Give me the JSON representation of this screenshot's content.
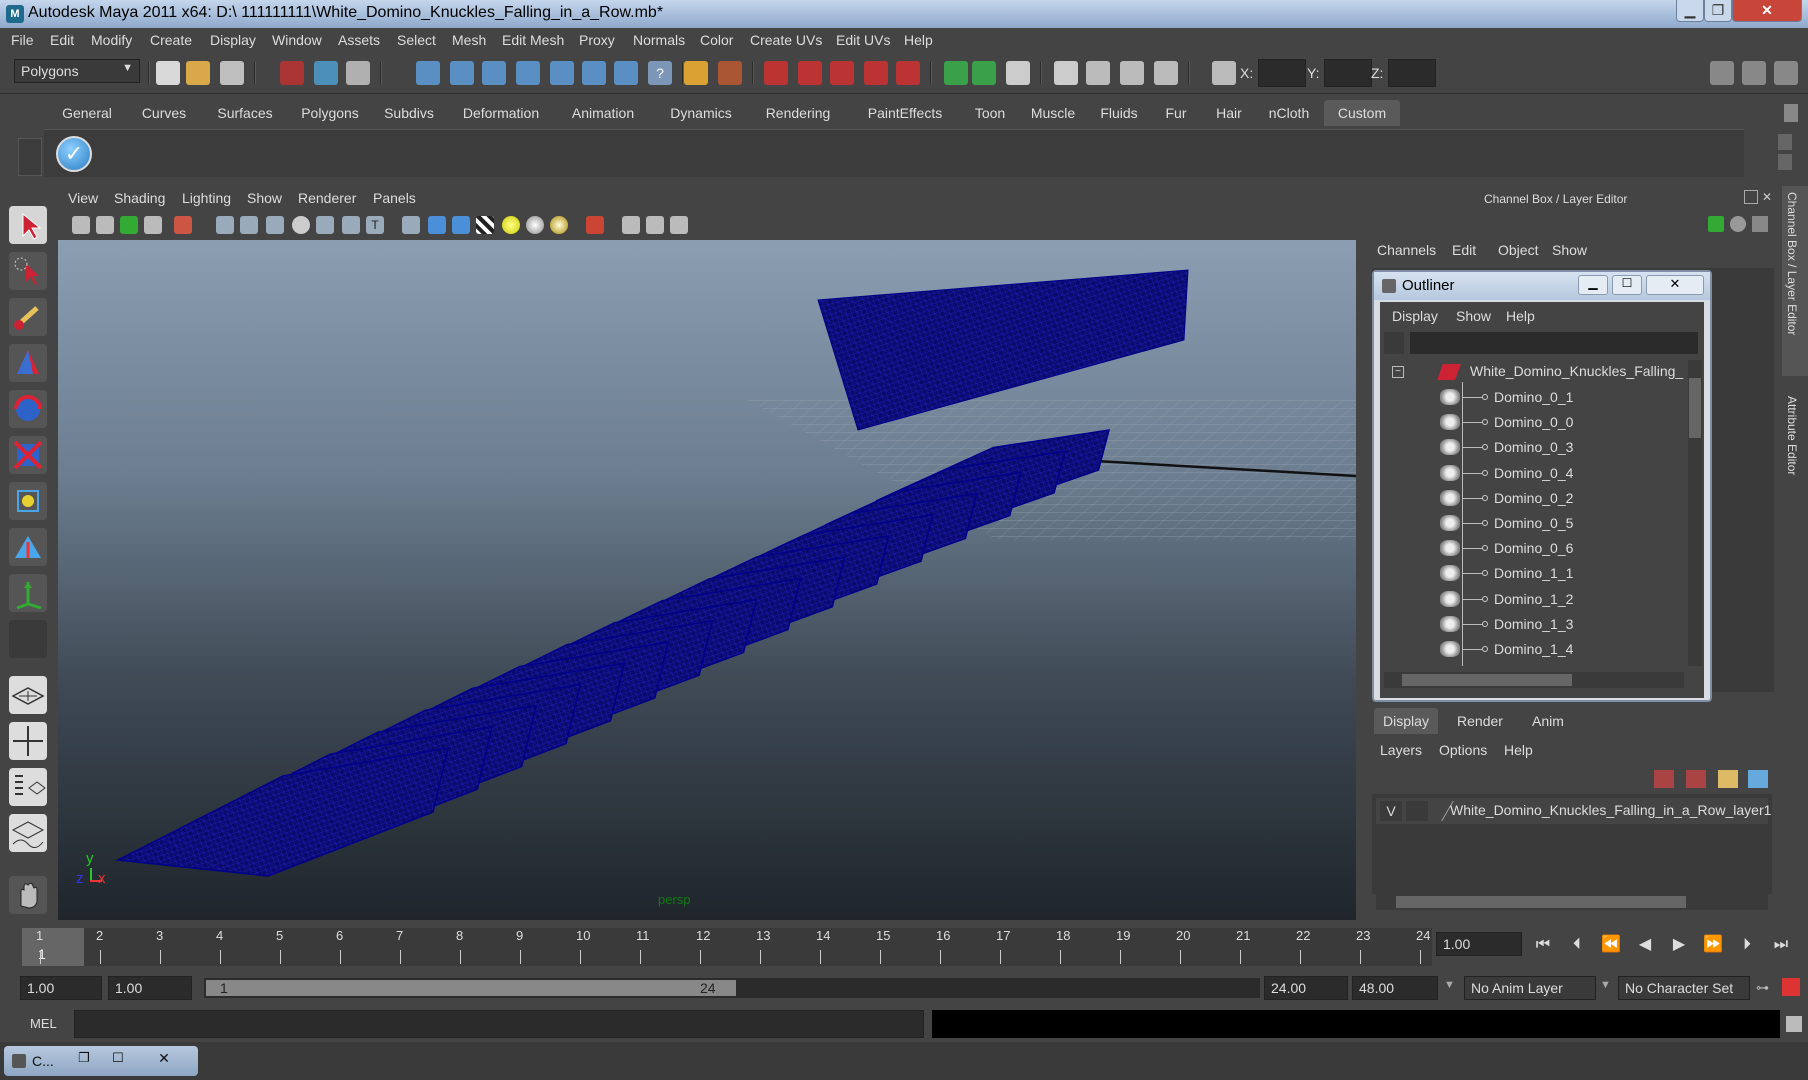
{
  "window": {
    "title": "Autodesk Maya 2011 x64: D:\\ 111111111\\White_Domino_Knuckles_Falling_in_a_Row.mb*",
    "app_icon": "M"
  },
  "menubar": [
    "File",
    "Edit",
    "Modify",
    "Create",
    "Display",
    "Window",
    "Assets",
    "Select",
    "Mesh",
    "Edit Mesh",
    "Proxy",
    "Normals",
    "Color",
    "Create UVs",
    "Edit UVs",
    "Help"
  ],
  "statusline": {
    "mode": "Polygons",
    "x_label": "X:",
    "y_label": "Y:",
    "z_label": "Z:"
  },
  "shelf": {
    "tabs": [
      "General",
      "Curves",
      "Surfaces",
      "Polygons",
      "Subdivs",
      "Deformation",
      "Animation",
      "Dynamics",
      "Rendering",
      "PaintEffects",
      "Toon",
      "Muscle",
      "Fluids",
      "Fur",
      "Hair",
      "nCloth",
      "Custom"
    ],
    "active_tab": "Custom"
  },
  "viewport": {
    "menus": [
      "View",
      "Shading",
      "Lighting",
      "Show",
      "Renderer",
      "Panels"
    ],
    "camera_label": "persp",
    "axis_y": "y",
    "axis_x": "x",
    "axis_z": "z",
    "wire_color": "#00008a"
  },
  "channel_box": {
    "title": "Channel Box / Layer Editor",
    "menus": [
      "Channels",
      "Edit",
      "Object",
      "Show"
    ],
    "side_tab_1": "Channel Box / Layer Editor",
    "side_tab_2": "Attribute Editor"
  },
  "outliner": {
    "title": "Outliner",
    "menus": [
      "Display",
      "Show",
      "Help"
    ],
    "root": "White_Domino_Knuckles_Falling_in",
    "items": [
      "Domino_0_1",
      "Domino_0_0",
      "Domino_0_3",
      "Domino_0_4",
      "Domino_0_2",
      "Domino_0_5",
      "Domino_0_6",
      "Domino_1_1",
      "Domino_1_2",
      "Domino_1_3",
      "Domino_1_4"
    ]
  },
  "layer_editor": {
    "tabs": [
      "Display",
      "Render",
      "Anim"
    ],
    "active_tab": "Display",
    "menus": [
      "Layers",
      "Options",
      "Help"
    ],
    "layer_visible": "V",
    "layer_name": "White_Domino_Knuckles_Falling_in_a_Row_layer1"
  },
  "timeline": {
    "ticks": [
      "1",
      "2",
      "3",
      "4",
      "5",
      "6",
      "7",
      "8",
      "9",
      "10",
      "11",
      "12",
      "13",
      "14",
      "15",
      "16",
      "17",
      "18",
      "19",
      "20",
      "21",
      "22",
      "23",
      "24"
    ],
    "current_frame_marker": "1",
    "current_time": "1.00",
    "start_min": "1.00",
    "start": "1.00",
    "range_start_label": "1",
    "range_end_label": "24",
    "end": "24.00",
    "end_max": "48.00",
    "anim_layer": "No Anim Layer",
    "character_set": "No Character Set"
  },
  "command_line": {
    "label": "MEL"
  },
  "taskbar": {
    "item": "C..."
  }
}
